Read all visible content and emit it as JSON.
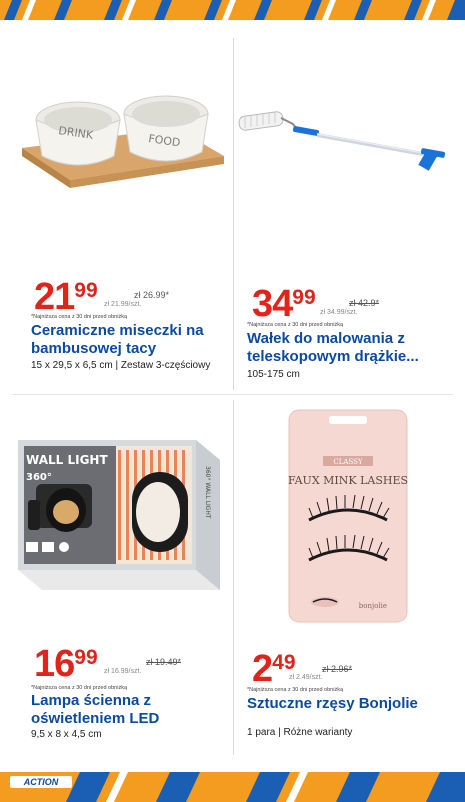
{
  "products": [
    {
      "price_main": "21",
      "price_cents": "99",
      "old_price": "zł 26.99*",
      "unit_price": "zł 21.99/szt.",
      "lowest_note": "*Najniższa cena z 30 dni przed obniżką",
      "title": "Ceramiczne miseczki na bambusowej tacy",
      "desc": "15 x 29,5 x 6,5 cm | Zestaw 3-częściowy",
      "image": {
        "bowl_left_text": "DRINK",
        "bowl_right_text": "FOOD"
      }
    },
    {
      "price_main": "34",
      "price_cents": "99",
      "old_price": "zł 42.9*",
      "unit_price": "zł 34.99/szt.",
      "lowest_note": "*Najniższa cena z 30 dni przed obniżką",
      "title": "Wałek do malowania z teleskopowym drążkie...",
      "desc": "105-175 cm",
      "image": {}
    },
    {
      "price_main": "16",
      "price_cents": "99",
      "old_price": "zł 19.49*",
      "unit_price": "zł 16.99/szt.",
      "lowest_note": "*Najniższa cena z 30 dni przed obniżką",
      "title": "Lampa ścienna z oświetleniem LED",
      "desc": "9,5 x 8 x 4,5 cm",
      "image": {
        "box_text": "WALL LIGHT",
        "box_sub": "360°",
        "side_text": "360° WALL LIGHT"
      }
    },
    {
      "price_main": "2",
      "price_cents": "49",
      "old_price": "zł 2.96*",
      "unit_price": "zł 2.49/szt.",
      "lowest_note": "*Najniższa cena z 30 dni przed obniżką",
      "title": "Sztuczne rzęsy Bonjolie",
      "desc": "1 para | Różne warianty",
      "image": {
        "brand_tag": "CLASSY",
        "box_title": "FAUX MINK LASHES",
        "brand": "bonjolie"
      }
    }
  ],
  "footer": {
    "logo": "ACTION"
  },
  "colors": {
    "price_red": "#e2231a",
    "title_blue": "#0b4aa2",
    "stripe_orange": "#f39c1f",
    "stripe_blue": "#1a5fb4"
  }
}
